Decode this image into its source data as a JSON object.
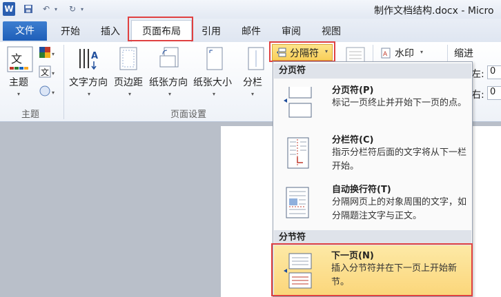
{
  "window": {
    "title": "制作文档结构.docx - Micro"
  },
  "quick_access": {
    "word_icon": "W",
    "save_icon": "save-icon",
    "undo_icon": "undo-icon",
    "redo_icon": "redo-icon"
  },
  "tabs": {
    "file": "文件",
    "home": "开始",
    "insert": "插入",
    "page_layout": "页面布局",
    "references": "引用",
    "mailings": "邮件",
    "review": "审阅",
    "view": "视图"
  },
  "ribbon": {
    "theme": {
      "label": "主题",
      "group": "主题"
    },
    "page_setup": {
      "group": "页面设置",
      "text_direction": "文字方向",
      "margins": "页边距",
      "orientation": "纸张方向",
      "size": "纸张大小",
      "columns": "分栏",
      "breaks": "分隔符"
    },
    "watermark": "水印",
    "indent": "缩进",
    "left": "左:",
    "right": "右:",
    "left_value": "0",
    "right_value": "0"
  },
  "menu": {
    "page_breaks_header": "分页符",
    "section_breaks_header": "分节符",
    "items": [
      {
        "title": "分页符(P)",
        "desc": "标记一页终止并开始下一页的点。"
      },
      {
        "title": "分栏符(C)",
        "desc": "指示分栏符后面的文字将从下一栏开始。"
      },
      {
        "title": "自动换行符(T)",
        "desc": "分隔网页上的对象周围的文字，如分隔题注文字与正文。"
      },
      {
        "title": "下一页(N)",
        "desc": "插入分节符并在下一页上开始新节。"
      }
    ]
  },
  "colors": {
    "file_tab": "#2a6ac4",
    "highlight_border": "#e04040",
    "selected_item": "#fbd67a"
  }
}
